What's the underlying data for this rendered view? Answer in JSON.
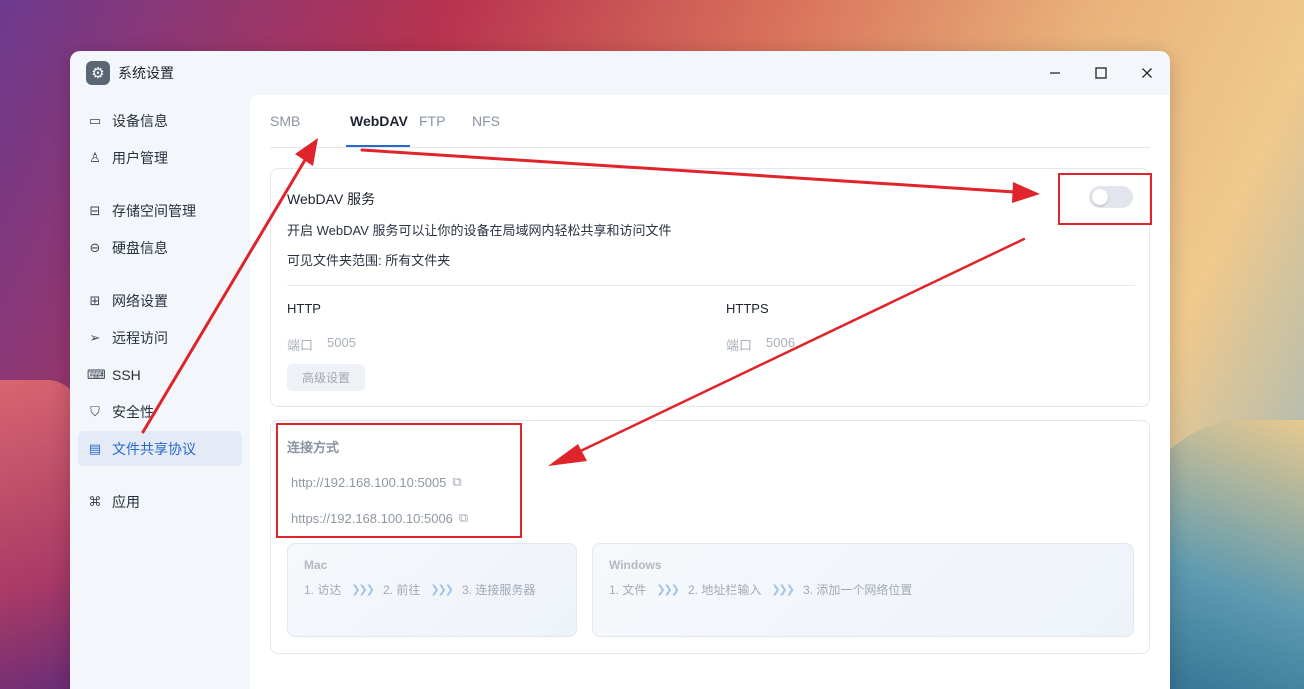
{
  "window": {
    "title": "系统设置",
    "controls": [
      "minimize",
      "maximize",
      "close"
    ]
  },
  "sidebar": {
    "items": [
      {
        "label": "设备信息",
        "icon": "device-icon"
      },
      {
        "label": "用户管理",
        "icon": "user-icon"
      },
      {
        "label": "存储空间管理",
        "icon": "storage-icon"
      },
      {
        "label": "硬盘信息",
        "icon": "disk-icon"
      },
      {
        "label": "网络设置",
        "icon": "network-icon"
      },
      {
        "label": "远程访问",
        "icon": "send-icon"
      },
      {
        "label": "SSH",
        "icon": "terminal-icon"
      },
      {
        "label": "安全性",
        "icon": "shield-icon"
      },
      {
        "label": "文件共享协议",
        "icon": "file-icon",
        "active": true
      },
      {
        "label": "应用",
        "icon": "apps-icon"
      }
    ]
  },
  "tabs": [
    {
      "label": "SMB"
    },
    {
      "label": "WebDAV",
      "active": true
    },
    {
      "label": "FTP"
    },
    {
      "label": "NFS"
    }
  ],
  "service": {
    "title": "WebDAV 服务",
    "description": "开启 WebDAV 服务可以让你的设备在局域网内轻松共享和访问文件",
    "scope": "可见文件夹范围:  所有文件夹",
    "enabled": false
  },
  "http": {
    "title": "HTTP",
    "port_label": "端口",
    "port": "5005"
  },
  "https": {
    "title": "HTTPS",
    "port_label": "端口",
    "port": "5006"
  },
  "advanced_button": "高级设置",
  "connection": {
    "title": "连接方式",
    "http_url": "http://192.168.100.10:5005",
    "https_url": "https://192.168.100.10:5006"
  },
  "mac": {
    "name": "Mac",
    "steps": [
      "1. 访达",
      "2. 前往",
      "3. 连接服务器"
    ]
  },
  "windows": {
    "name": "Windows",
    "steps": [
      "1. 文件",
      "2. 地址栏输入",
      "3. 添加一个网络位置"
    ]
  },
  "colors": {
    "accent": "#2869c9",
    "annotation": "#e0242b"
  }
}
